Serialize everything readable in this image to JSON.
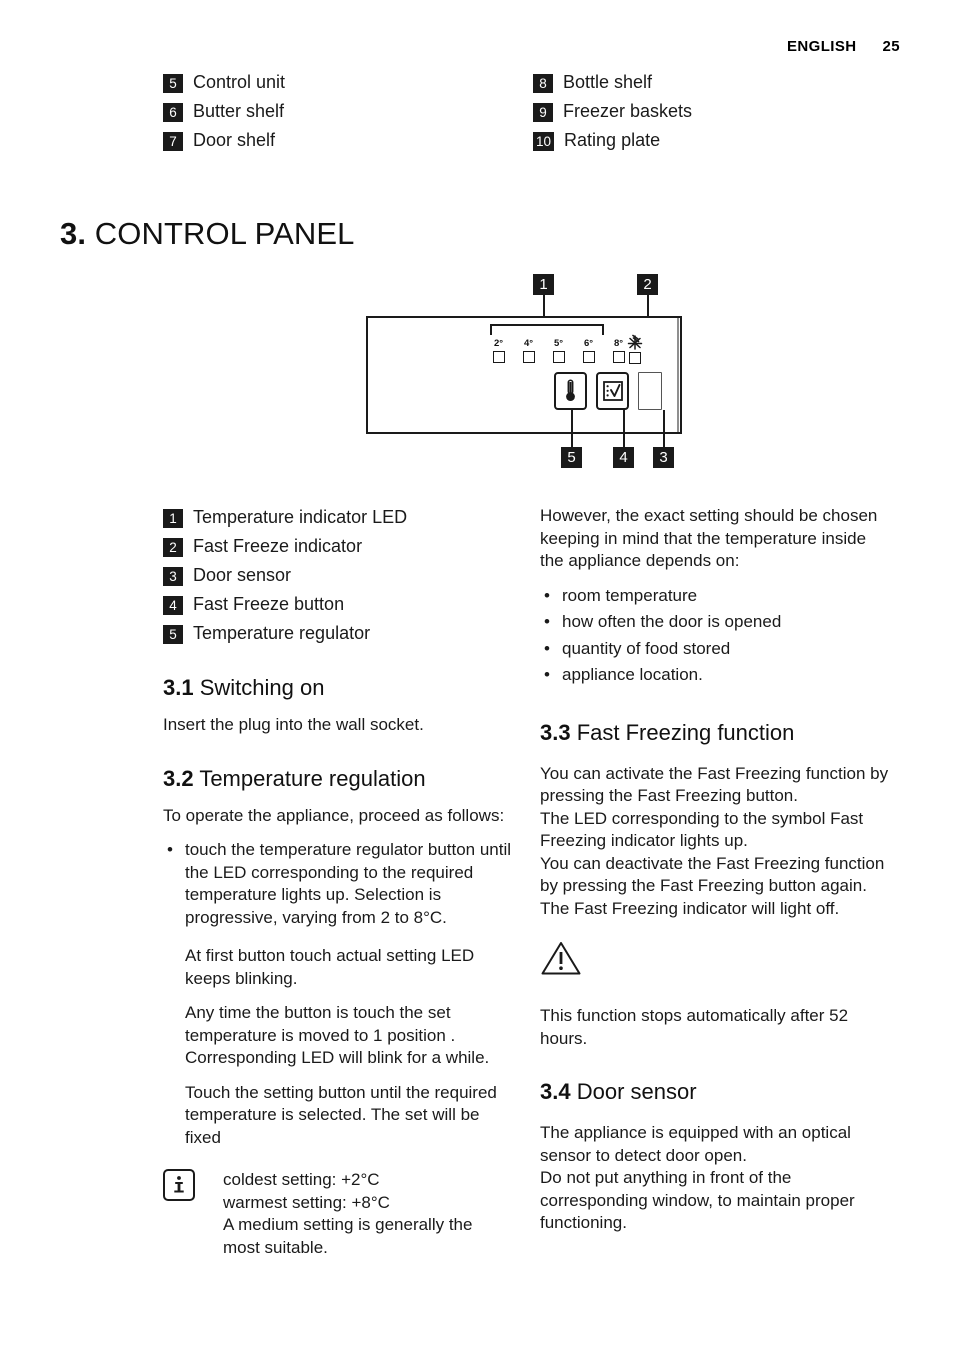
{
  "header": {
    "language": "ENGLISH",
    "page_number": "25"
  },
  "parts": {
    "left": [
      {
        "num": "5",
        "label": "Control unit"
      },
      {
        "num": "6",
        "label": "Butter shelf"
      },
      {
        "num": "7",
        "label": "Door shelf"
      }
    ],
    "right": [
      {
        "num": "8",
        "label": "Bottle shelf"
      },
      {
        "num": "9",
        "label": "Freezer baskets"
      },
      {
        "num": "10",
        "label": "Rating plate"
      }
    ]
  },
  "chapter": {
    "number": "3.",
    "title": "CONTROL PANEL"
  },
  "figure": {
    "callouts": [
      "1",
      "2",
      "3",
      "4",
      "5"
    ],
    "led_labels": [
      "2°",
      "4°",
      "5°",
      "6°",
      "8°"
    ],
    "fast_freeze_symbol": "snowflake-icon",
    "temperature_button_icon": "thermometer-icon",
    "fast_freeze_button_icon": "fast-freeze-icon",
    "door_sensor_icon": "door-sensor-window"
  },
  "legend": [
    {
      "num": "1",
      "label": "Temperature indicator LED"
    },
    {
      "num": "2",
      "label": "Fast Freeze indicator"
    },
    {
      "num": "3",
      "label": "Door sensor"
    },
    {
      "num": "4",
      "label": "Fast Freeze button"
    },
    {
      "num": "5",
      "label": "Temperature regulator"
    }
  ],
  "sections": {
    "switching_on": {
      "number": "3.1",
      "title": "Switching on",
      "body": "Insert the plug into the wall socket."
    },
    "temperature_regulation": {
      "number": "3.2",
      "title": "Temperature regulation",
      "intro": "To operate the appliance, proceed as follows:",
      "bullet": "touch the temperature regulator button until the LED corresponding to the required temperature lights up. Selection is progressive, varying from 2 to 8°C.",
      "para2": "At first button touch actual setting LED keeps blinking.",
      "para3": "Any time the button is touch the set temperature is moved to 1 position . Corresponding LED will blink for a while.",
      "para4": "Touch the setting button until the required temperature is selected. The set will be fixed",
      "info": "coldest setting: +2°C\nwarmest setting: +8°C\nA medium setting is generally the most suitable."
    },
    "right_intro": {
      "body": "However, the exact setting should be chosen keeping in mind that the temperature inside the appliance depends on:",
      "bullets": [
        "room temperature",
        "how often the door is opened",
        "quantity of food stored",
        "appliance location."
      ]
    },
    "fast_freezing": {
      "number": "3.3",
      "title": "Fast Freezing function",
      "body": "You can activate the Fast Freezing function by pressing the Fast Freezing button.\nThe LED corresponding to the symbol Fast Freezing indicator lights up.\nYou can deactivate the Fast Freezing function by pressing the Fast Freezing button again.\nThe Fast Freezing indicator will light off.",
      "warning": "This function stops automatically after 52 hours."
    },
    "door_sensor": {
      "number": "3.4",
      "title": "Door sensor",
      "body": "The appliance is equipped with an optical sensor to detect door open.\nDo not put anything in front of the corresponding window, to maintain proper functioning."
    }
  },
  "colors": {
    "ink": "#1a1a1a",
    "paper": "#ffffff"
  }
}
